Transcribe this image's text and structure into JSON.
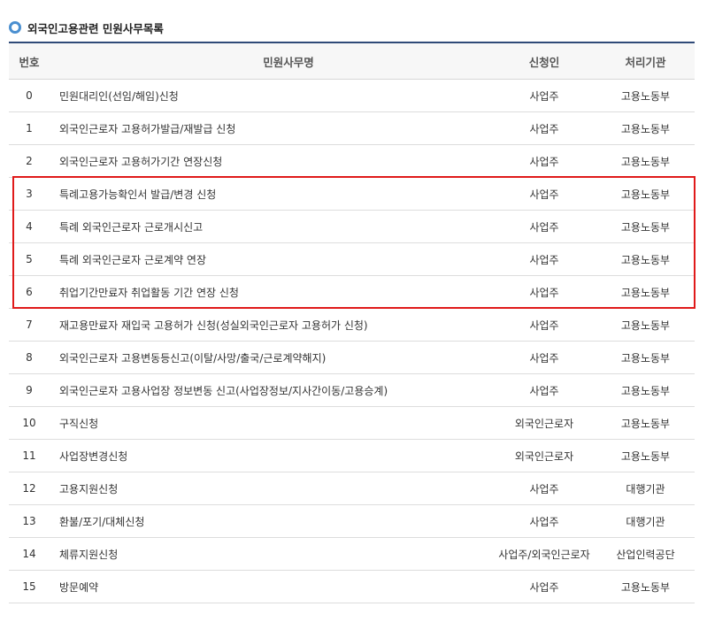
{
  "section": {
    "title": "외국인고용관련 민원사무목록",
    "icon": "circle-bullet-icon",
    "accent_color": "#4a8fd0"
  },
  "table": {
    "headers": {
      "no": "번호",
      "name": "민원사무명",
      "applicant": "신청인",
      "org": "처리기관"
    },
    "rows": [
      {
        "no": "0",
        "name": "민원대리인(선임/해임)신청",
        "applicant": "사업주",
        "org": "고용노동부"
      },
      {
        "no": "1",
        "name": "외국인근로자 고용허가발급/재발급 신청",
        "applicant": "사업주",
        "org": "고용노동부"
      },
      {
        "no": "2",
        "name": "외국인근로자 고용허가기간 연장신청",
        "applicant": "사업주",
        "org": "고용노동부"
      },
      {
        "no": "3",
        "name": "특례고용가능확인서 발급/변경 신청",
        "applicant": "사업주",
        "org": "고용노동부"
      },
      {
        "no": "4",
        "name": "특례 외국인근로자 근로개시신고",
        "applicant": "사업주",
        "org": "고용노동부"
      },
      {
        "no": "5",
        "name": "특례 외국인근로자 근로계약 연장",
        "applicant": "사업주",
        "org": "고용노동부"
      },
      {
        "no": "6",
        "name": "취업기간만료자 취업활동 기간 연장 신청",
        "applicant": "사업주",
        "org": "고용노동부"
      },
      {
        "no": "7",
        "name": "재고용만료자 재입국 고용허가 신청(성실외국인근로자 고용허가 신청)",
        "applicant": "사업주",
        "org": "고용노동부"
      },
      {
        "no": "8",
        "name": "외국인근로자 고용변동등신고(이탈/사망/출국/근로계약해지)",
        "applicant": "사업주",
        "org": "고용노동부"
      },
      {
        "no": "9",
        "name": "외국인근로자 고용사업장 정보변동 신고(사업장정보/지사간이동/고용승계)",
        "applicant": "사업주",
        "org": "고용노동부"
      },
      {
        "no": "10",
        "name": "구직신청",
        "applicant": "외국인근로자",
        "org": "고용노동부"
      },
      {
        "no": "11",
        "name": "사업장변경신청",
        "applicant": "외국인근로자",
        "org": "고용노동부"
      },
      {
        "no": "12",
        "name": "고용지원신청",
        "applicant": "사업주",
        "org": "대행기관"
      },
      {
        "no": "13",
        "name": "환불/포기/대체신청",
        "applicant": "사업주",
        "org": "대행기관"
      },
      {
        "no": "14",
        "name": "체류지원신청",
        "applicant": "사업주/외국인근로자",
        "org": "산업인력공단"
      },
      {
        "no": "15",
        "name": "방문예약",
        "applicant": "사업주",
        "org": "고용노동부"
      }
    ]
  },
  "highlight": {
    "color": "#e01a1a",
    "rows_from": "3",
    "rows_to": "6"
  }
}
